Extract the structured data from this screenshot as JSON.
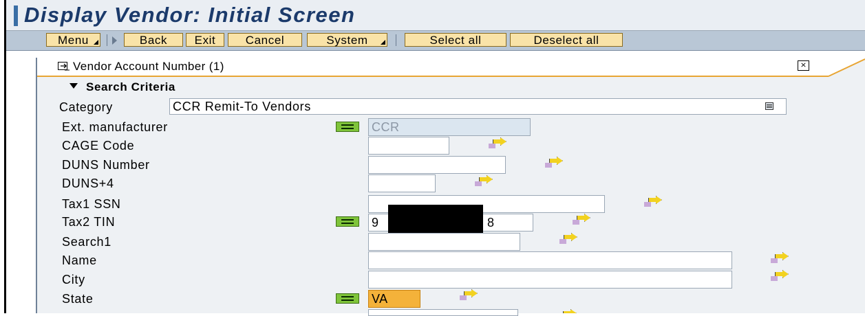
{
  "window": {
    "title": "Display Vendor: Initial Screen"
  },
  "toolbar": {
    "menu": "Menu",
    "back": "Back",
    "exit": "Exit",
    "cancel": "Cancel",
    "system": "System",
    "select_all": "Select all",
    "deselect_all": "Deselect all"
  },
  "panel": {
    "header": "Vendor Account Number (1)",
    "close_symbol": "⨯",
    "section_title": "Search Criteria",
    "category_label": "Category",
    "category_value": "CCR Remit-To Vendors"
  },
  "fields": [
    {
      "label": "Ext. manufacturer",
      "value": "CCR",
      "operator": true,
      "disabled": true
    },
    {
      "label": "CAGE Code",
      "value": ""
    },
    {
      "label": "DUNS Number",
      "value": ""
    },
    {
      "label": "DUNS+4",
      "value": ""
    },
    {
      "label": "Tax1 SSN",
      "value": ""
    },
    {
      "label": "Tax2 TIN",
      "value_start": "9",
      "value_end": "8",
      "operator": true,
      "redacted": true
    },
    {
      "label": "Search1",
      "value": ""
    },
    {
      "label": "Name",
      "value": ""
    },
    {
      "label": "City",
      "value": ""
    },
    {
      "label": "State",
      "value": "VA",
      "operator": true,
      "active": true
    }
  ],
  "icons": {
    "multiple_selection": "multiple-selection-icon",
    "operator_equals": "equals-operator-icon",
    "dropdown": "dropdown-icon"
  },
  "colors": {
    "title_text": "#1b3a6b",
    "toolbar_button": "#f9e3a8",
    "operator_green": "#7fc43a",
    "active_field": "#f4b23a",
    "panel_accent": "#e8a533"
  }
}
